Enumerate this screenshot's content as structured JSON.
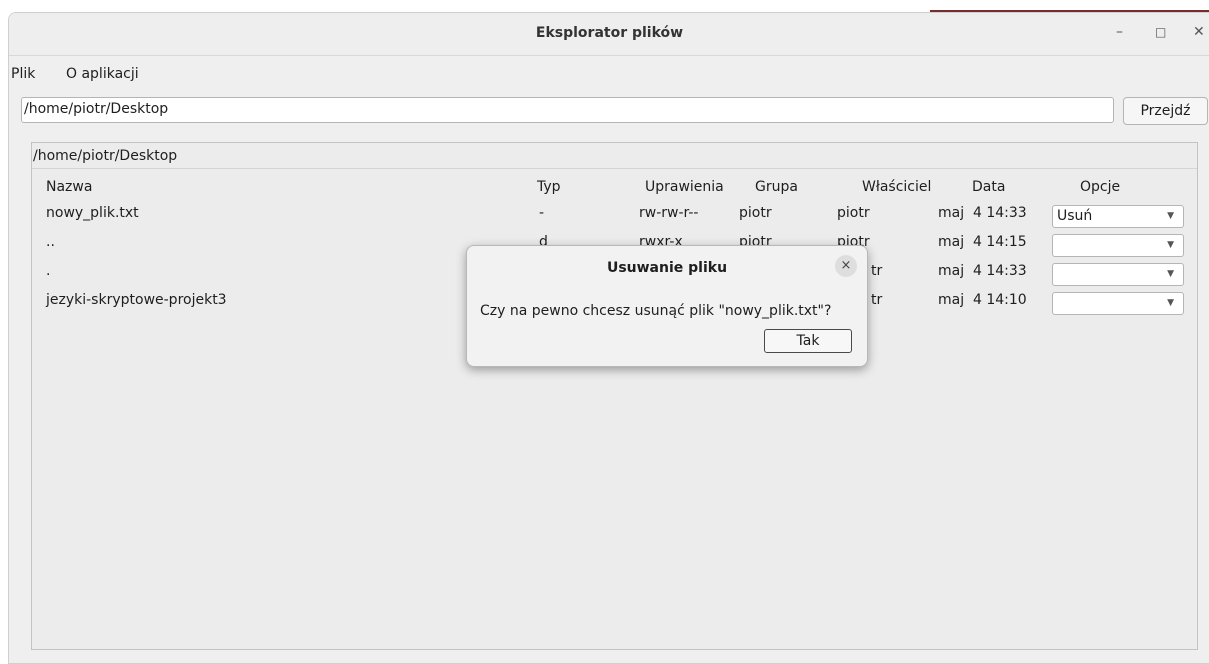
{
  "window": {
    "title": "Eksplorator plików",
    "controls": {
      "minimize": "–",
      "maximize": "□",
      "close": "✕"
    }
  },
  "menu": {
    "items": [
      "Plik",
      "O aplikacji"
    ]
  },
  "path_bar": {
    "value": "/home/piotr/Desktop",
    "go_label": "Przejdź"
  },
  "file_group": {
    "title": "/home/piotr/Desktop",
    "headers": {
      "name": "Nazwa",
      "type": "Typ",
      "permissions": "Uprawienia",
      "group": "Grupa",
      "owner": "Właściciel",
      "date": "Data",
      "options": "Opcje"
    },
    "rows": [
      {
        "name": "nowy_plik.txt",
        "type": "-",
        "permissions": "rw-rw-r--",
        "group": "piotr",
        "owner": "piotr",
        "month": "maj",
        "date": "4 14:33",
        "option": "Usuń"
      },
      {
        "name": "..",
        "type": "d",
        "permissions": "rwxr-x",
        "group": "piotr",
        "owner": "piotr",
        "month": "maj",
        "date": "4 14:15",
        "option": ""
      },
      {
        "name": ".",
        "type": "",
        "permissions": "",
        "group": "",
        "owner": "tr",
        "month": "maj",
        "date": "4 14:33",
        "option": ""
      },
      {
        "name": "jezyki-skryptowe-projekt3",
        "type": "",
        "permissions": "",
        "group": "",
        "owner": "tr",
        "month": "maj",
        "date": "4 14:10",
        "option": ""
      }
    ]
  },
  "dialog": {
    "title": "Usuwanie pliku",
    "message": "Czy na pewno chcesz usunąć plik \"nowy_plik.txt\"?",
    "confirm_label": "Tak",
    "close_glyph": "×"
  }
}
